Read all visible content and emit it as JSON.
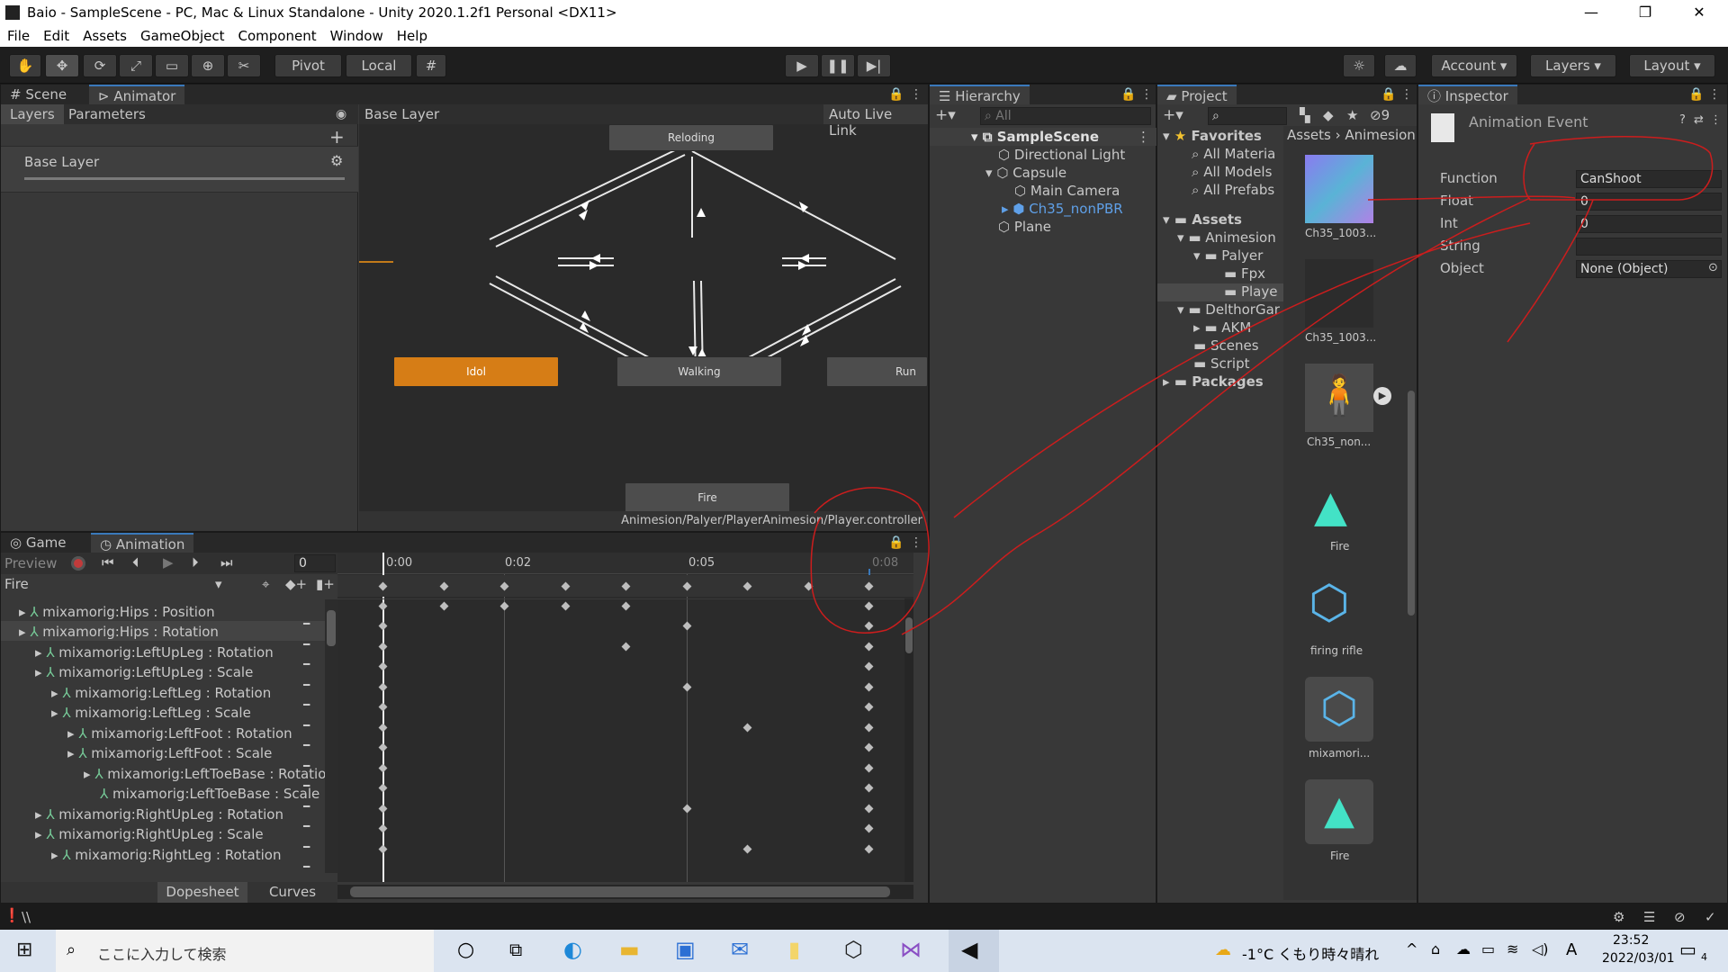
{
  "window": {
    "title": "Baio - SampleScene - PC, Mac & Linux Standalone - Unity 2020.1.2f1 Personal <DX11>",
    "minimize": "—",
    "maximize": "❐",
    "close": "✕"
  },
  "menu": [
    "File",
    "Edit",
    "Assets",
    "GameObject",
    "Component",
    "Window",
    "Help"
  ],
  "toolbar": {
    "pivot": "Pivot",
    "local": "Local",
    "account": "Account",
    "layers": "Layers",
    "layout": "Layout"
  },
  "scene_panel": {
    "tabs": [
      "Scene",
      "Animator"
    ],
    "subtabs": [
      "Layers",
      "Parameters"
    ],
    "breadcrumb": "Base Layer",
    "auto_live_link": "Auto Live Link",
    "layer_name": "Base Layer",
    "footer_path": "Animesion/Palyer/PlayerAnimesion/Player.controller",
    "states": {
      "reloding": "Reloding",
      "idol": "Idol",
      "walking": "Walking",
      "run": "Run",
      "fire": "Fire"
    }
  },
  "animation_panel": {
    "tabs": [
      "Game",
      "Animation"
    ],
    "preview": "Preview",
    "frame": "0",
    "clip": "Fire",
    "timeline": [
      "0:00",
      "0:02",
      "0:05",
      "0:08"
    ],
    "properties": [
      "mixamorig:Hips : Position",
      "mixamorig:Hips : Rotation",
      "mixamorig:LeftUpLeg : Rotation",
      "mixamorig:LeftUpLeg : Scale",
      "mixamorig:LeftLeg : Rotation",
      "mixamorig:LeftLeg : Scale",
      "mixamorig:LeftFoot : Rotation",
      "mixamorig:LeftFoot : Scale",
      "mixamorig:LeftToeBase : Rotatio",
      "mixamorig:LeftToeBase : Scale",
      "mixamorig:RightUpLeg : Rotation",
      "mixamorig:RightUpLeg : Scale",
      "mixamorig:RightLeg : Rotation"
    ],
    "bottom_tabs": [
      "Dopesheet",
      "Curves"
    ]
  },
  "hierarchy": {
    "tab": "Hierarchy",
    "search_placeholder": "All",
    "scene": "SampleScene",
    "items": [
      "Directional Light",
      "Capsule",
      "Main Camera",
      "Ch35_nonPBR",
      "Plane"
    ]
  },
  "project": {
    "tab": "Project",
    "breadcrumb": [
      "Assets",
      "Animesion"
    ],
    "hidden_count": "9",
    "tree": [
      "Favorites",
      "All Materia",
      "All Models",
      "All Prefabs",
      "Assets",
      "Animesion",
      "Palyer",
      "Fpx",
      "Playe",
      "DelthorGar",
      "AKM",
      "Scenes",
      "Script",
      "Packages"
    ],
    "assets": [
      "Ch35_1003...",
      "Ch35_1003...",
      "Ch35_non...",
      "Fire",
      "firing rifle",
      "mixamori...",
      "Fire"
    ]
  },
  "inspector": {
    "tab": "Inspector",
    "title": "Animation Event",
    "fields": {
      "function": {
        "label": "Function",
        "value": "CanShoot"
      },
      "float": {
        "label": "Float",
        "value": "0"
      },
      "int": {
        "label": "Int",
        "value": "0"
      },
      "string": {
        "label": "String",
        "value": ""
      },
      "object": {
        "label": "Object",
        "value": "None (Object)"
      }
    }
  },
  "status": {
    "text": "\\\\"
  },
  "taskbar": {
    "search": "ここに入力して検索",
    "weather": "-1°C くもり時々晴れ",
    "ime": "A",
    "time": "23:52",
    "date": "2022/03/01",
    "notifications": "4"
  },
  "colors": {
    "accent": "#3a79bb",
    "selected_state": "#d67d16",
    "annotation": "#cc1d1d"
  }
}
